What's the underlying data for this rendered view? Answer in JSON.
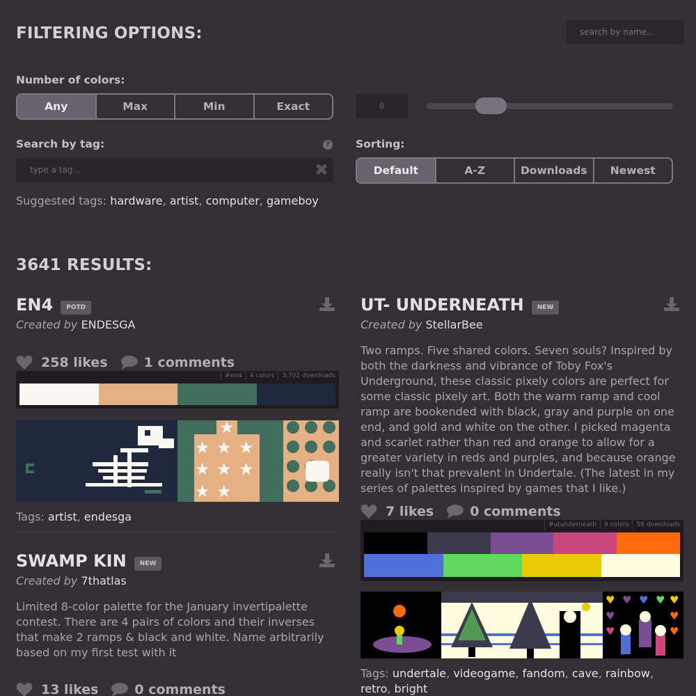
{
  "filter": {
    "title": "FILTERING OPTIONS:",
    "search_name_placeholder": "search by name...",
    "num_colors_label": "Number of colors:",
    "num_colors_options": [
      "Any",
      "Max",
      "Min",
      "Exact"
    ],
    "num_colors_value": "8",
    "slider_level_fraction": 0.23,
    "tag_label": "Search by tag:",
    "tag_placeholder": "type a tag...",
    "help_glyph": "?",
    "clear_glyph": "✖",
    "sorting_label": "Sorting:",
    "sorting_options": [
      "Default",
      "A-Z",
      "Downloads",
      "Newest"
    ],
    "suggested_label": "Suggested tags:",
    "suggested_tags": [
      "hardware",
      "artist",
      "computer",
      "gameboy"
    ]
  },
  "results_title": "3641 RESULTS:",
  "cards": [
    {
      "title": "EN4",
      "badge": "POTD",
      "created_prefix": "Created by",
      "author": "ENDESGA",
      "likes": "258 likes",
      "comments": "1 comments",
      "meta": [
        "#en4",
        "4 colors",
        "3,702 downloads"
      ],
      "colors": [
        "#fbf7f3",
        "#e5b083",
        "#426e5d",
        "#20283d"
      ],
      "tags_label": "Tags:",
      "tags": [
        "artist",
        "endesga"
      ]
    },
    {
      "title": "UT- UNDERNEATH",
      "badge": "NEW",
      "created_prefix": "Created by",
      "author": "StellarBee",
      "description": "Two ramps. Five shared colors. Seven souls? Inspired by both the darkness and vibrance of Toby Fox's Underground, these classic pixely colors are perfect for some classic pixely art. Both the warm ramp and cool ramp are bookended with black, gray and purple on one end, and gold and white on the other. I picked magenta and scarlet rather than red and orange to allow for a greater variety in reds and purples, and because orange really isn't that prevalent in Undertale. (The latest in my series of palettes inspired by games that I like.)",
      "likes": "7 likes",
      "comments": "0 comments",
      "meta": [
        "#utunderneath",
        "9 colors",
        "58 downloads"
      ],
      "colors_row1": [
        "#000000",
        "#3c3b4d",
        "#7b4d92",
        "#c9477b",
        "#ff6a0b"
      ],
      "colors_row2": [
        "#4f6fd9",
        "#5fd95b",
        "#e8cb05",
        "#fffce0"
      ],
      "tags_label": "Tags:",
      "tags": [
        "undertale",
        "videogame",
        "fandom",
        "cave",
        "rainbow",
        "retro",
        "bright"
      ]
    },
    {
      "title": "SWAMP KIN",
      "badge": "NEW",
      "created_prefix": "Created by",
      "author": "7thatlas",
      "description": "Limited 8-color palette for the January invertipalette contest. There are 4 pairs of colors and their inverses that make 2 ramps & black and white. Name arbitrarily based on my first test with it",
      "likes": "13 likes",
      "comments": "0 comments"
    }
  ],
  "colors": {
    "background": "#332f35",
    "accent_active": "#67636d",
    "link_text": "#e5e3e8"
  },
  "icons": [
    "heart-icon",
    "comment-icon",
    "download-icon",
    "help-icon",
    "clear-icon"
  ]
}
